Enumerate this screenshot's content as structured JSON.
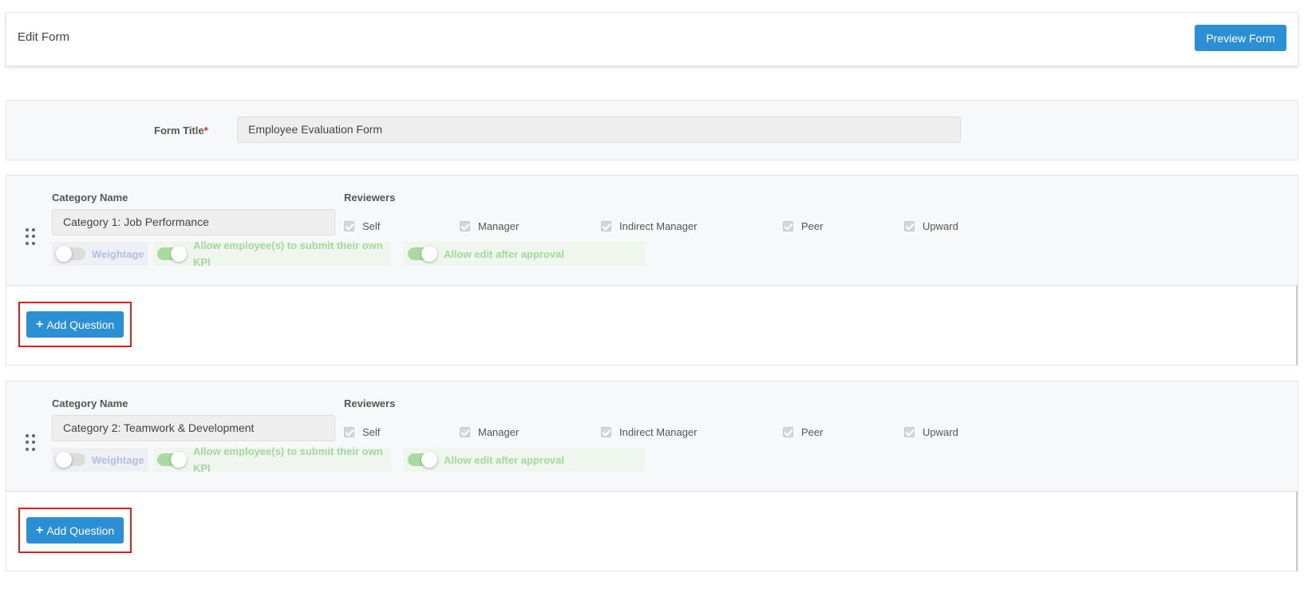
{
  "header": {
    "title": "Edit Form",
    "preview_label": "Preview Form"
  },
  "form": {
    "title_label": "Form Title",
    "required_mark": "*",
    "title_value": "Employee Evaluation Form"
  },
  "categories": [
    {
      "name_label": "Category Name",
      "name_value": "Category 1: Job Performance",
      "reviewers_label": "Reviewers",
      "reviewers": [
        {
          "label": "Self",
          "checked": true
        },
        {
          "label": "Manager",
          "checked": true
        },
        {
          "label": "Indirect Manager",
          "checked": true
        },
        {
          "label": "Peer",
          "checked": true
        },
        {
          "label": "Upward",
          "checked": true
        }
      ],
      "weightage_label": "Weightage",
      "weightage_on": false,
      "kpi_label": "Allow employee(s) to submit their own KPI",
      "kpi_on": true,
      "approval_label": "Allow edit after approval",
      "approval_on": true,
      "add_question_label": "Add Question"
    },
    {
      "name_label": "Category Name",
      "name_value": "Category 2: Teamwork & Development",
      "reviewers_label": "Reviewers",
      "reviewers": [
        {
          "label": "Self",
          "checked": true
        },
        {
          "label": "Manager",
          "checked": true
        },
        {
          "label": "Indirect Manager",
          "checked": true
        },
        {
          "label": "Peer",
          "checked": true
        },
        {
          "label": "Upward",
          "checked": true
        }
      ],
      "weightage_label": "Weightage",
      "weightage_on": false,
      "kpi_label": "Allow employee(s) to submit their own KPI",
      "kpi_on": true,
      "approval_label": "Allow edit after approval",
      "approval_on": true,
      "add_question_label": "Add Question"
    }
  ],
  "colors": {
    "primary": "#2b8fd6",
    "highlight_border": "#e01e1e",
    "toggle_on": "#a8dba0",
    "required": "#e02020"
  }
}
